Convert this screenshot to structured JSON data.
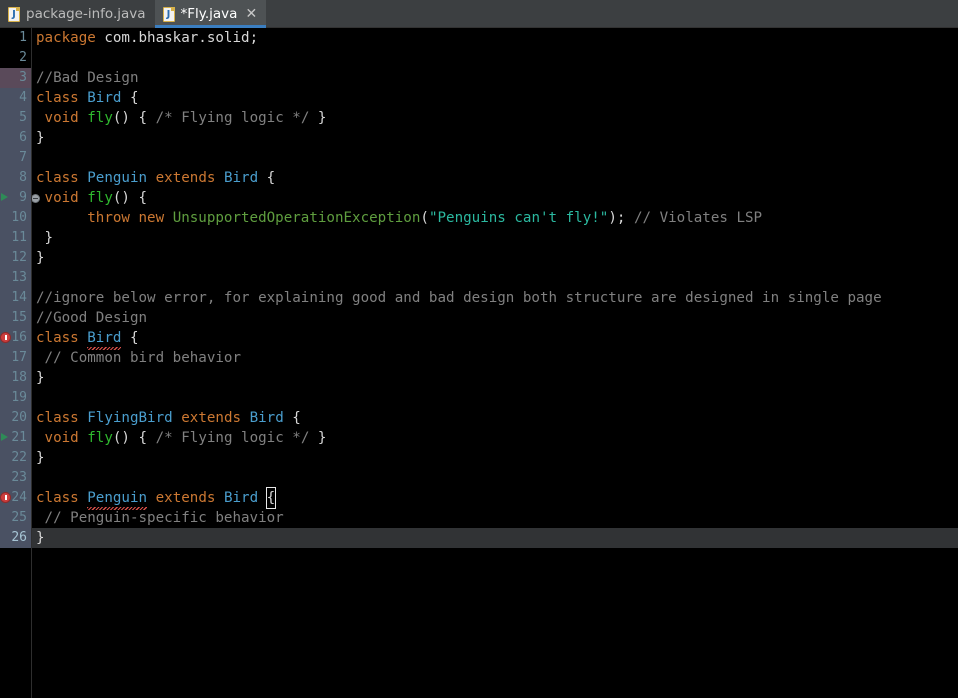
{
  "window": {
    "app": "java-ide-editor",
    "theme_background": "#000000",
    "accent": "#3b7ec0"
  },
  "tabbar": {
    "tabs": [
      {
        "label": "package-info.java",
        "icon": "java-file-icon",
        "active": false,
        "modified": false,
        "closable": false
      },
      {
        "label": "*Fly.java",
        "icon": "java-file-icon",
        "active": true,
        "modified": true,
        "closable": true,
        "close_glyph": "✕"
      }
    ]
  },
  "editor": {
    "language": "java",
    "current_line": 26,
    "first_visible_line": 1,
    "last_visible_line": 26,
    "colors": {
      "keyword": "#cc7832",
      "class_name": "#4a9ece",
      "method": "#2eb82e",
      "comment": "#808080",
      "string": "#2bb9a0",
      "exception_type": "#5f9e3f",
      "text": "#d8d8d8",
      "current_line_bg": "#313335",
      "modified_gutter_bg": "#4a5163",
      "error_marker": "#cc3d3d",
      "implements_marker": "#2e8b57",
      "error_squiggle": "#d9504a"
    },
    "lines": [
      {
        "n": 1,
        "gutter": "none",
        "text": "package com.bhaskar.solid;"
      },
      {
        "n": 2,
        "gutter": "none",
        "text": ""
      },
      {
        "n": 3,
        "gutter": "mod2",
        "text": "//Bad Design"
      },
      {
        "n": 4,
        "gutter": "mod",
        "text": "class Bird {"
      },
      {
        "n": 5,
        "gutter": "mod",
        "text": " void fly() { /* Flying logic */ }"
      },
      {
        "n": 6,
        "gutter": "mod",
        "text": "}"
      },
      {
        "n": 7,
        "gutter": "mod",
        "text": ""
      },
      {
        "n": 8,
        "gutter": "mod",
        "text": "class Penguin extends Bird {"
      },
      {
        "n": 9,
        "gutter": "mod",
        "marker": "implements-triangle",
        "override": true,
        "text": " void fly() {"
      },
      {
        "n": 10,
        "gutter": "mod",
        "text": "      throw new UnsupportedOperationException(\"Penguins can't fly!\"); // Violates LSP"
      },
      {
        "n": 11,
        "gutter": "mod",
        "text": " }"
      },
      {
        "n": 12,
        "gutter": "mod",
        "text": "}"
      },
      {
        "n": 13,
        "gutter": "mod",
        "text": ""
      },
      {
        "n": 14,
        "gutter": "mod",
        "text": "//ignore below error, for explaining good and bad design both structure are designed in single page"
      },
      {
        "n": 15,
        "gutter": "mod",
        "text": "//Good Design"
      },
      {
        "n": 16,
        "gutter": "mod",
        "marker": "error-dot",
        "text": "class Bird {"
      },
      {
        "n": 17,
        "gutter": "mod",
        "text": " // Common bird behavior"
      },
      {
        "n": 18,
        "gutter": "mod",
        "text": "}"
      },
      {
        "n": 19,
        "gutter": "mod",
        "text": ""
      },
      {
        "n": 20,
        "gutter": "mod",
        "text": "class FlyingBird extends Bird {"
      },
      {
        "n": 21,
        "gutter": "mod",
        "marker": "implements-triangle",
        "text": " void fly() { /* Flying logic */ }"
      },
      {
        "n": 22,
        "gutter": "mod",
        "text": "}"
      },
      {
        "n": 23,
        "gutter": "mod",
        "text": ""
      },
      {
        "n": 24,
        "gutter": "mod",
        "marker": "error-dot",
        "text": "class Penguin extends Bird {"
      },
      {
        "n": 25,
        "gutter": "mod",
        "text": " // Penguin-specific behavior"
      },
      {
        "n": 26,
        "gutter": "cur",
        "text": "}"
      }
    ]
  }
}
